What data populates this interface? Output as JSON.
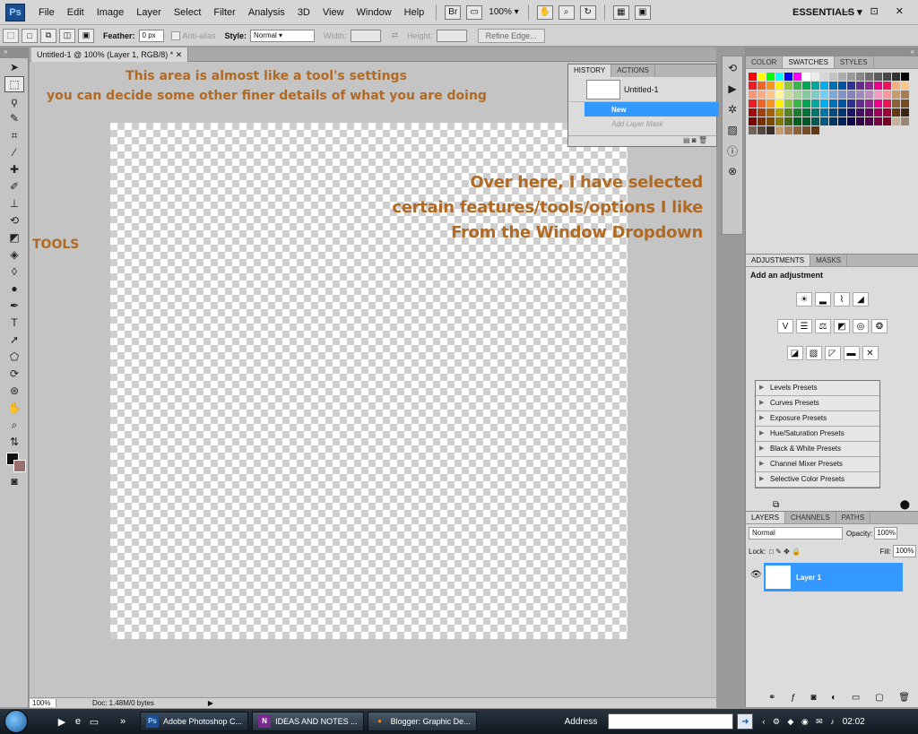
{
  "menubar": {
    "logo": "Ps",
    "items": [
      "File",
      "Edit",
      "Image",
      "Layer",
      "Select",
      "Filter",
      "Analysis",
      "3D",
      "View",
      "Window",
      "Help"
    ],
    "zoom": "100%",
    "workspace": "ESSENTIALS",
    "window_controls": "— ⊡ ✕"
  },
  "options": {
    "feather_label": "Feather:",
    "feather_value": "0 px",
    "antialias_label": "Anti-alias",
    "style_label": "Style:",
    "style_value": "Normal",
    "width_label": "Width:",
    "height_label": "Height:",
    "refine_edge": "Refine Edge..."
  },
  "document": {
    "tab_title": "Untitled-1 @ 100% (Layer 1, RGB/8) *",
    "status_zoom": "100%",
    "status_doc": "Doc: 1.48M/0 bytes"
  },
  "annotations": {
    "top_line1": "This area is almost like a tool's settings",
    "top_line2": "you can decide some other finer details of what you are doing",
    "right_line1": "Over here, I have selected",
    "right_line2": "certain features/tools/options I like",
    "right_line3": "From the Window Dropdown",
    "tools_label": "TOOLS"
  },
  "history": {
    "tabs": [
      "HISTORY",
      "ACTIONS"
    ],
    "snapshot": "Untitled-1",
    "steps": [
      {
        "label": "New",
        "selected": true
      },
      {
        "label": "Add Layer Mask",
        "selected": false
      }
    ]
  },
  "color_panel": {
    "tabs": [
      "COLOR",
      "SWATCHES",
      "STYLES"
    ],
    "swatches": [
      "#ff0000",
      "#ffff00",
      "#00ff00",
      "#00ffff",
      "#0000ff",
      "#ff00ff",
      "#ffffff",
      "#ebebeb",
      "#d6d6d6",
      "#c2c2c2",
      "#adadad",
      "#999999",
      "#858585",
      "#707070",
      "#5c5c5c",
      "#474747",
      "#333333",
      "#000000",
      "#ee1d24",
      "#f26522",
      "#f7941d",
      "#fff200",
      "#8dc63f",
      "#39b54a",
      "#00a651",
      "#00a99d",
      "#00aeef",
      "#0072bc",
      "#0054a6",
      "#2e3192",
      "#662d91",
      "#92278f",
      "#ec008c",
      "#ed145b",
      "#f9ad81",
      "#fdc689",
      "#f7977a",
      "#f9ad81",
      "#fdc68a",
      "#fff79a",
      "#c4df9b",
      "#a3d39c",
      "#82ca9d",
      "#7bcdc8",
      "#6ecff6",
      "#7da7d9",
      "#8393ca",
      "#8781bd",
      "#a187be",
      "#bc8dbf",
      "#f49ac2",
      "#f6989d",
      "#c69c6d",
      "#a67c52",
      "#ed1c24",
      "#f26522",
      "#f7941d",
      "#fff200",
      "#8dc73f",
      "#39b54a",
      "#00a651",
      "#00a99d",
      "#00aeef",
      "#0072bc",
      "#0054a6",
      "#2e3192",
      "#662d91",
      "#92278f",
      "#ec008c",
      "#ed145b",
      "#8c6239",
      "#754c24",
      "#9e0b0f",
      "#a0410d",
      "#a36209",
      "#aba000",
      "#598527",
      "#1a7b30",
      "#007236",
      "#00746b",
      "#0076a3",
      "#004b80",
      "#003471",
      "#1b1464",
      "#440e62",
      "#630460",
      "#9e005d",
      "#9e0039",
      "#603913",
      "#3c2415",
      "#790000",
      "#7b2e00",
      "#7d4900",
      "#827b00",
      "#406618",
      "#005e20",
      "#005826",
      "#005952",
      "#005b7f",
      "#003663",
      "#002157",
      "#0d004c",
      "#32004b",
      "#4b0049",
      "#7b0046",
      "#7a0026",
      "#c7b299",
      "#998675",
      "#736357",
      "#534741",
      "#37302a",
      "#c69c6d",
      "#a67c52",
      "#8c6239",
      "#754c24",
      "#603913"
    ]
  },
  "adjustments": {
    "tabs": [
      "ADJUSTMENTS",
      "MASKS"
    ],
    "title": "Add an adjustment",
    "presets": [
      "Levels Presets",
      "Curves Presets",
      "Exposure Presets",
      "Hue/Saturation Presets",
      "Black & White Presets",
      "Channel Mixer Presets",
      "Selective Color Presets"
    ]
  },
  "layers": {
    "tabs": [
      "LAYERS",
      "CHANNELS",
      "PATHS"
    ],
    "blend_mode": "Normal",
    "opacity_label": "Opacity:",
    "opacity_value": "100%",
    "lock_label": "Lock:",
    "fill_label": "Fill:",
    "fill_value": "100%",
    "layer_name": "Layer 1"
  },
  "taskbar": {
    "tasks": [
      {
        "icon": "Ps",
        "label": "Adobe Photoshop C..."
      },
      {
        "icon": "N",
        "label": "IDEAS AND NOTES ..."
      },
      {
        "icon": "●",
        "label": "Blogger: Graphic De..."
      }
    ],
    "address_label": "Address",
    "clock": "02:02"
  }
}
